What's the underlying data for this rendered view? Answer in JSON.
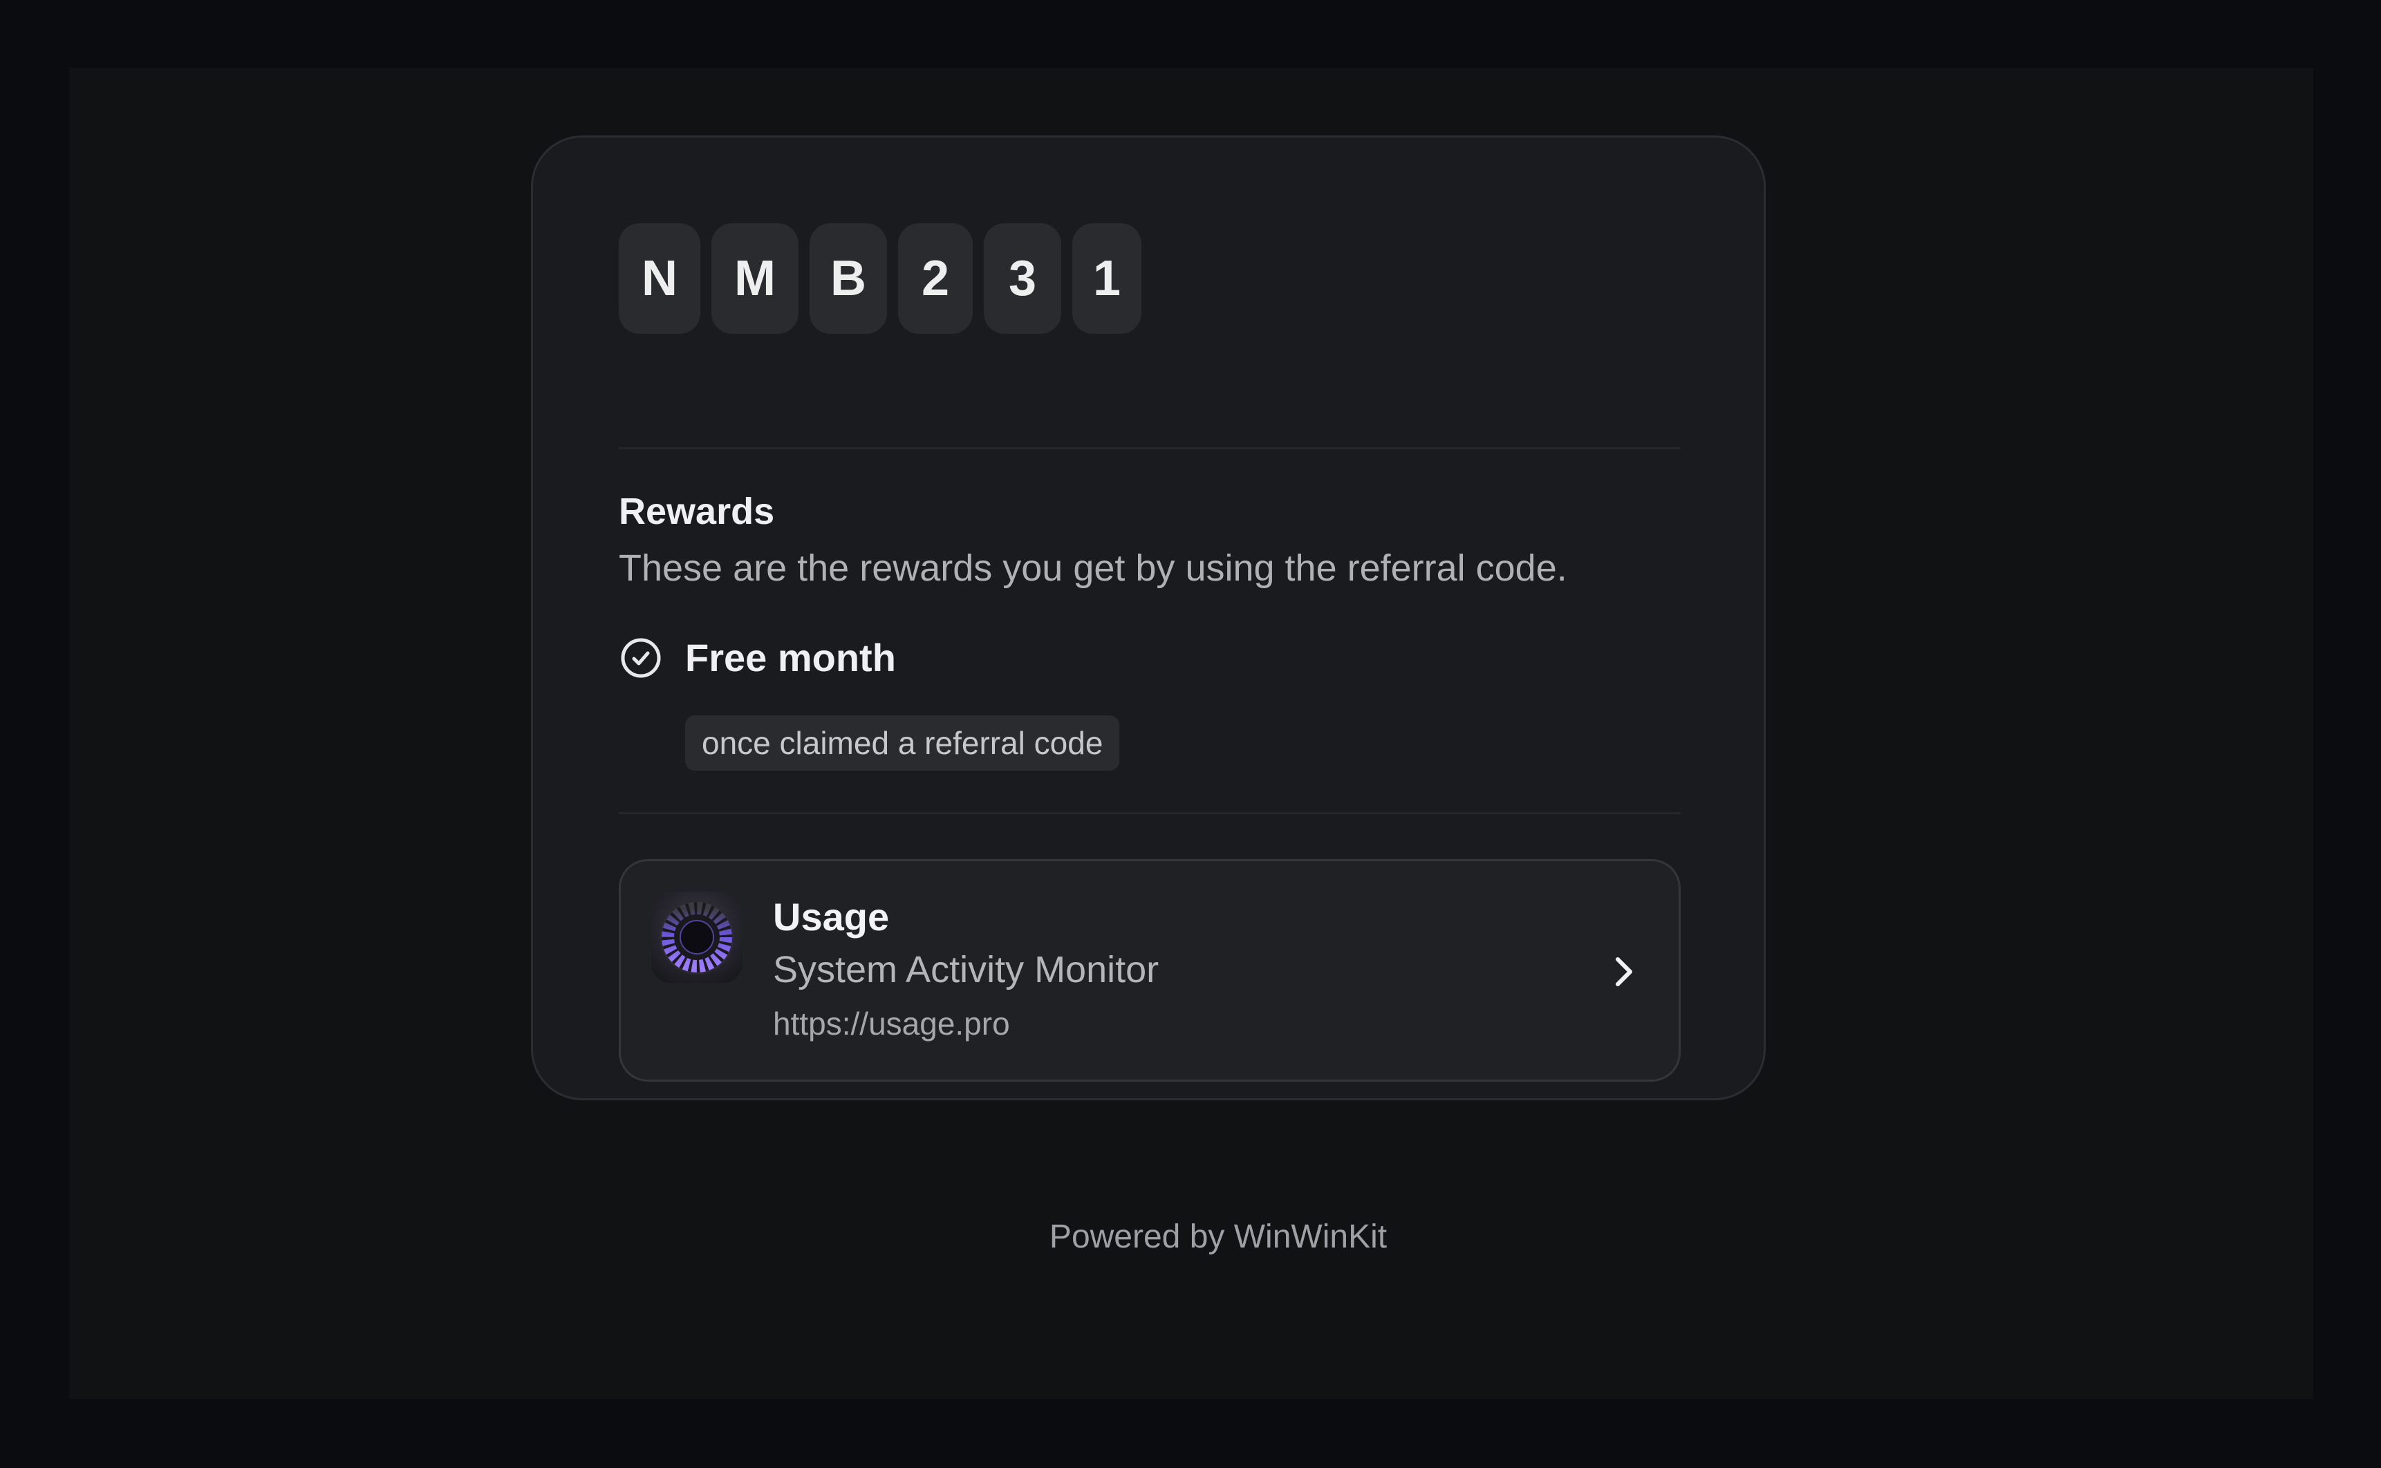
{
  "referral_code": {
    "characters": [
      "N",
      "M",
      "B",
      "2",
      "3",
      "1"
    ]
  },
  "rewards": {
    "title": "Rewards",
    "description": "These are the rewards you get by using the referral code.",
    "items": [
      {
        "icon": "check-circle-icon",
        "name": "Free month",
        "condition": "once claimed a referral code"
      }
    ]
  },
  "app": {
    "icon": "usage-app-icon",
    "name": "Usage",
    "subtitle": "System Activity Monitor",
    "url": "https://usage.pro",
    "action_icon": "chevron-right-icon"
  },
  "footer": {
    "text": "Powered by WinWinKit"
  },
  "colors": {
    "background": "#0b0c0f",
    "panel": "#111214",
    "card": "#1a1b1e",
    "code_tile": "#2a2b2f",
    "accent_purple": "#8b6cf0",
    "text_primary": "#f0f0f2",
    "text_secondary": "#b0b1b6"
  }
}
